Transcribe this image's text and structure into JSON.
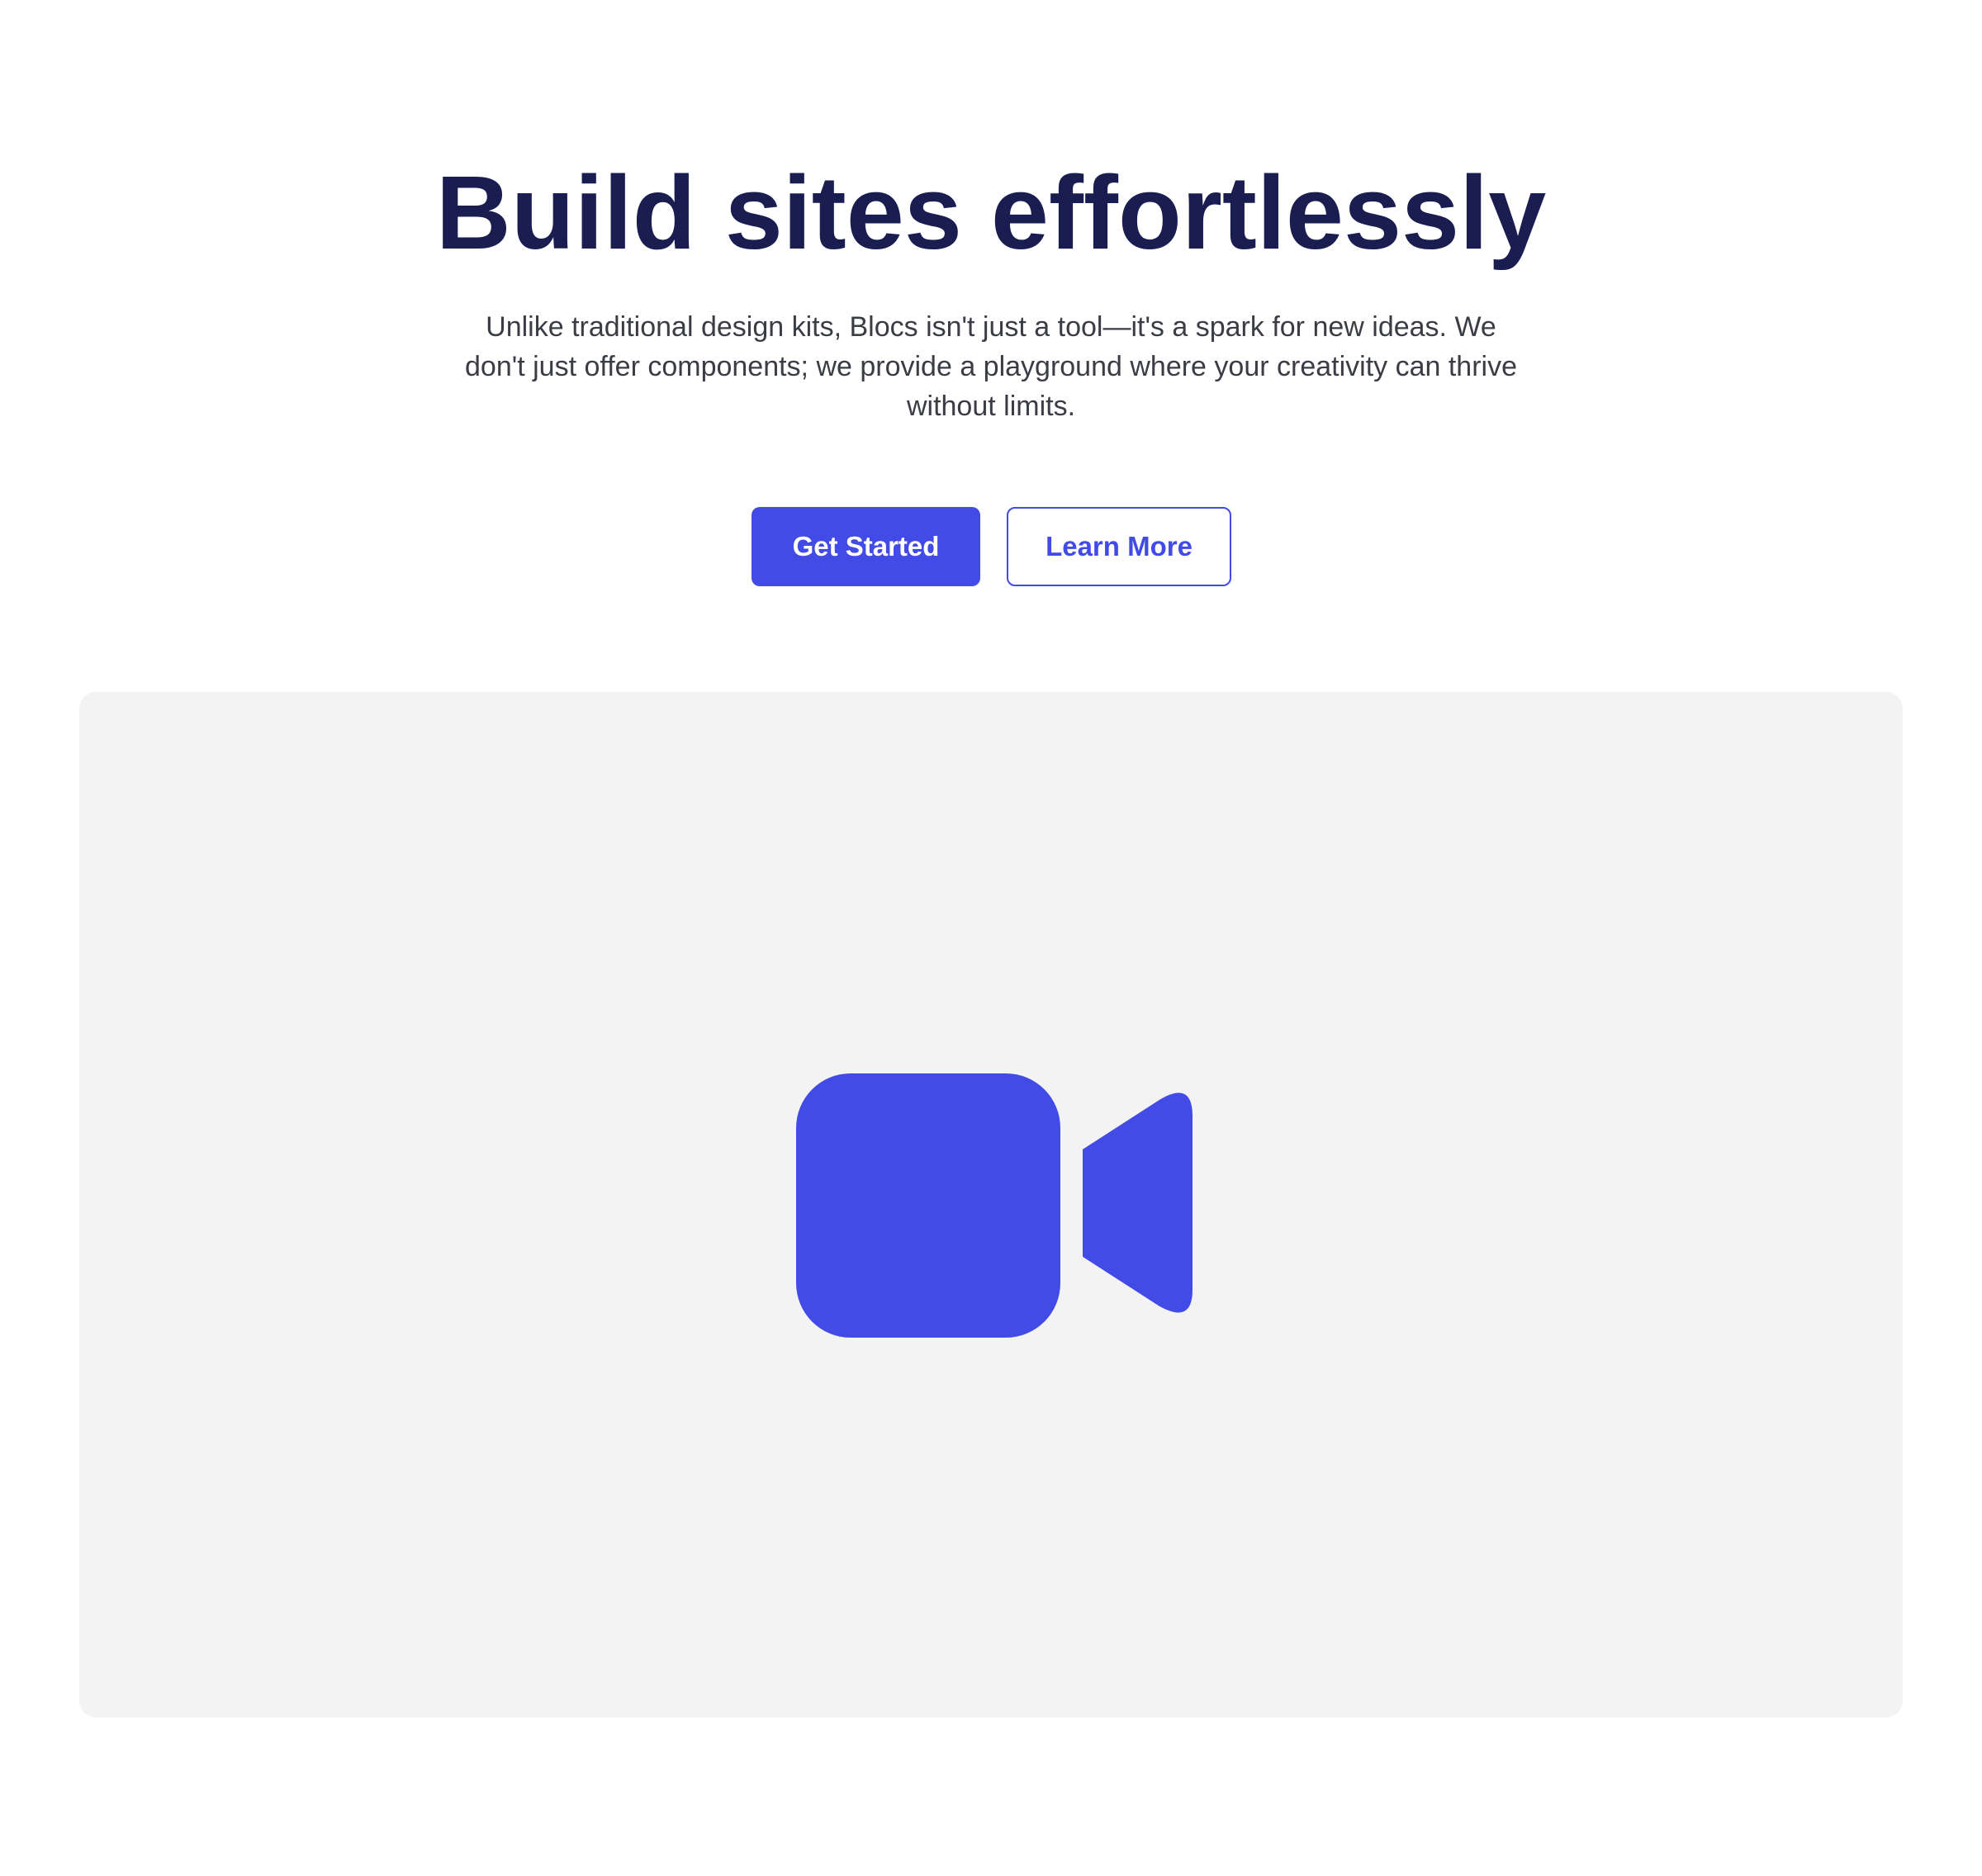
{
  "hero": {
    "title": "Build sites effortlessly",
    "subtitle": "Unlike traditional design kits, Blocs isn't just a tool—it's a spark for new ideas. We don't just offer components; we provide a playground where your creativity can thrive without limits."
  },
  "buttons": {
    "primary_label": "Get Started",
    "secondary_label": "Learn More"
  },
  "media": {
    "icon": "video-camera-icon"
  },
  "colors": {
    "accent": "#434be6",
    "title": "#191d4f",
    "body_text": "#3a3d45",
    "panel_bg": "#f3f3f3",
    "page_bg": "#ffffff"
  }
}
